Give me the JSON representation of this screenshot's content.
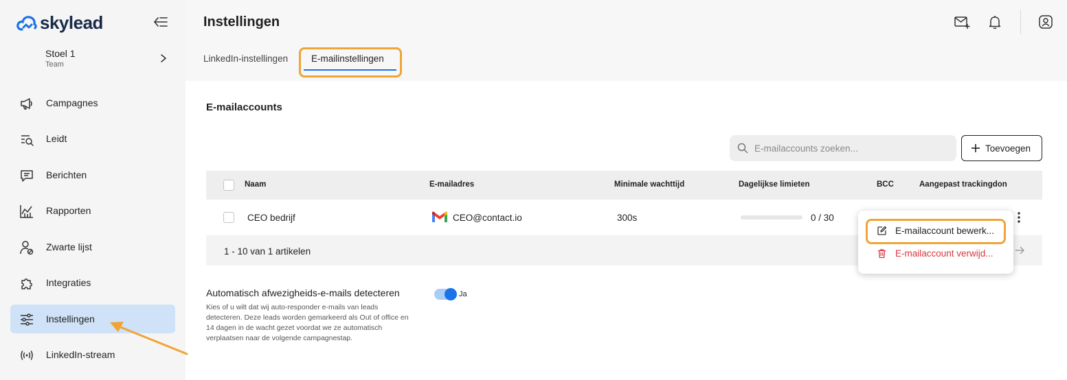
{
  "brand": {
    "name": "skylead",
    "accent": "#1a73e8",
    "highlight": "#f0a436"
  },
  "sidebar": {
    "team": {
      "name": "Stoel 1",
      "role": "Team"
    },
    "items": [
      {
        "label": "Campagnes",
        "icon": "megaphone-icon"
      },
      {
        "label": "Leidt",
        "icon": "lead-search-icon"
      },
      {
        "label": "Berichten",
        "icon": "message-icon"
      },
      {
        "label": "Rapporten",
        "icon": "chart-icon"
      },
      {
        "label": "Zwarte lijst",
        "icon": "blacklist-user-icon"
      },
      {
        "label": "Integraties",
        "icon": "puzzle-icon"
      },
      {
        "label": "Instellingen",
        "icon": "sliders-icon",
        "active": true
      },
      {
        "label": "LinkedIn-stream",
        "icon": "broadcast-icon"
      }
    ]
  },
  "header": {
    "title": "Instellingen",
    "tabs": [
      {
        "label": "LinkedIn-instellingen"
      },
      {
        "label": "E-mailinstellingen",
        "active": true
      }
    ]
  },
  "main": {
    "section_title": "E-mailaccounts",
    "search": {
      "placeholder": "E-mailaccounts zoeken...",
      "value": ""
    },
    "add_button": "Toevoegen",
    "table": {
      "columns": [
        "Naam",
        "E-mailadres",
        "Minimale wachttijd",
        "Dagelijkse limieten",
        "BCC",
        "Aangepast trackingdon"
      ],
      "rows": [
        {
          "name": "CEO bedrijf",
          "email": "CEO@contact.io",
          "min_wait": "300s",
          "daily_limit": "0 / 30",
          "daily_progress": 0
        }
      ],
      "pager": "1 - 10 van 1 artikelen"
    },
    "row_menu": {
      "edit": "E-mailaccount bewerk...",
      "delete": "E-mailaccount verwijd..."
    },
    "auto_detect": {
      "title": "Automatisch afwezigheids-e-mails detecteren",
      "description": "Kies of u wilt dat wij auto-responder e-mails van leads detecteren. Deze leads worden gemarkeerd als Out of office en 14 dagen in de wacht gezet voordat we ze automatisch verplaatsen naar de volgende campagnestap.",
      "toggle_label": "Ja",
      "enabled": true
    }
  }
}
